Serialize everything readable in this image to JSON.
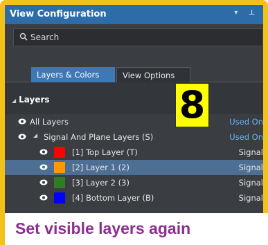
{
  "panel": {
    "title": "View Configuration",
    "title_icons": "▾ ⊥"
  },
  "search": {
    "placeholder": "Search"
  },
  "tabs": [
    {
      "label": "Layers & Colors",
      "active": true
    },
    {
      "label": "View Options",
      "active": false
    }
  ],
  "section": {
    "title": "Layers"
  },
  "layers": {
    "all": {
      "name": "All Layers",
      "type": "Used On"
    },
    "group": {
      "name": "Signal And Plane Layers (S)",
      "type": "Used On"
    },
    "items": [
      {
        "name": "[1] Top Layer (T)",
        "type": "Signal",
        "color": "#ff0000",
        "highlighted": false
      },
      {
        "name": "[2] Layer 1 (2)",
        "type": "Signal",
        "color": "#ff9900",
        "highlighted": true
      },
      {
        "name": "[3] Layer 2 (3)",
        "type": "Signal",
        "color": "#2e7d24",
        "highlighted": false
      },
      {
        "name": "[4] Bottom Layer (B)",
        "type": "Signal",
        "color": "#0000ff",
        "highlighted": false
      }
    ]
  },
  "annotation": {
    "step": "8",
    "caption": "Set visible layers again"
  },
  "colors": {
    "accent_border": "#f2c21a",
    "title_bar": "#2c6ca8",
    "active_tab": "#3d79b6",
    "caption_text": "#8a2f8f"
  }
}
